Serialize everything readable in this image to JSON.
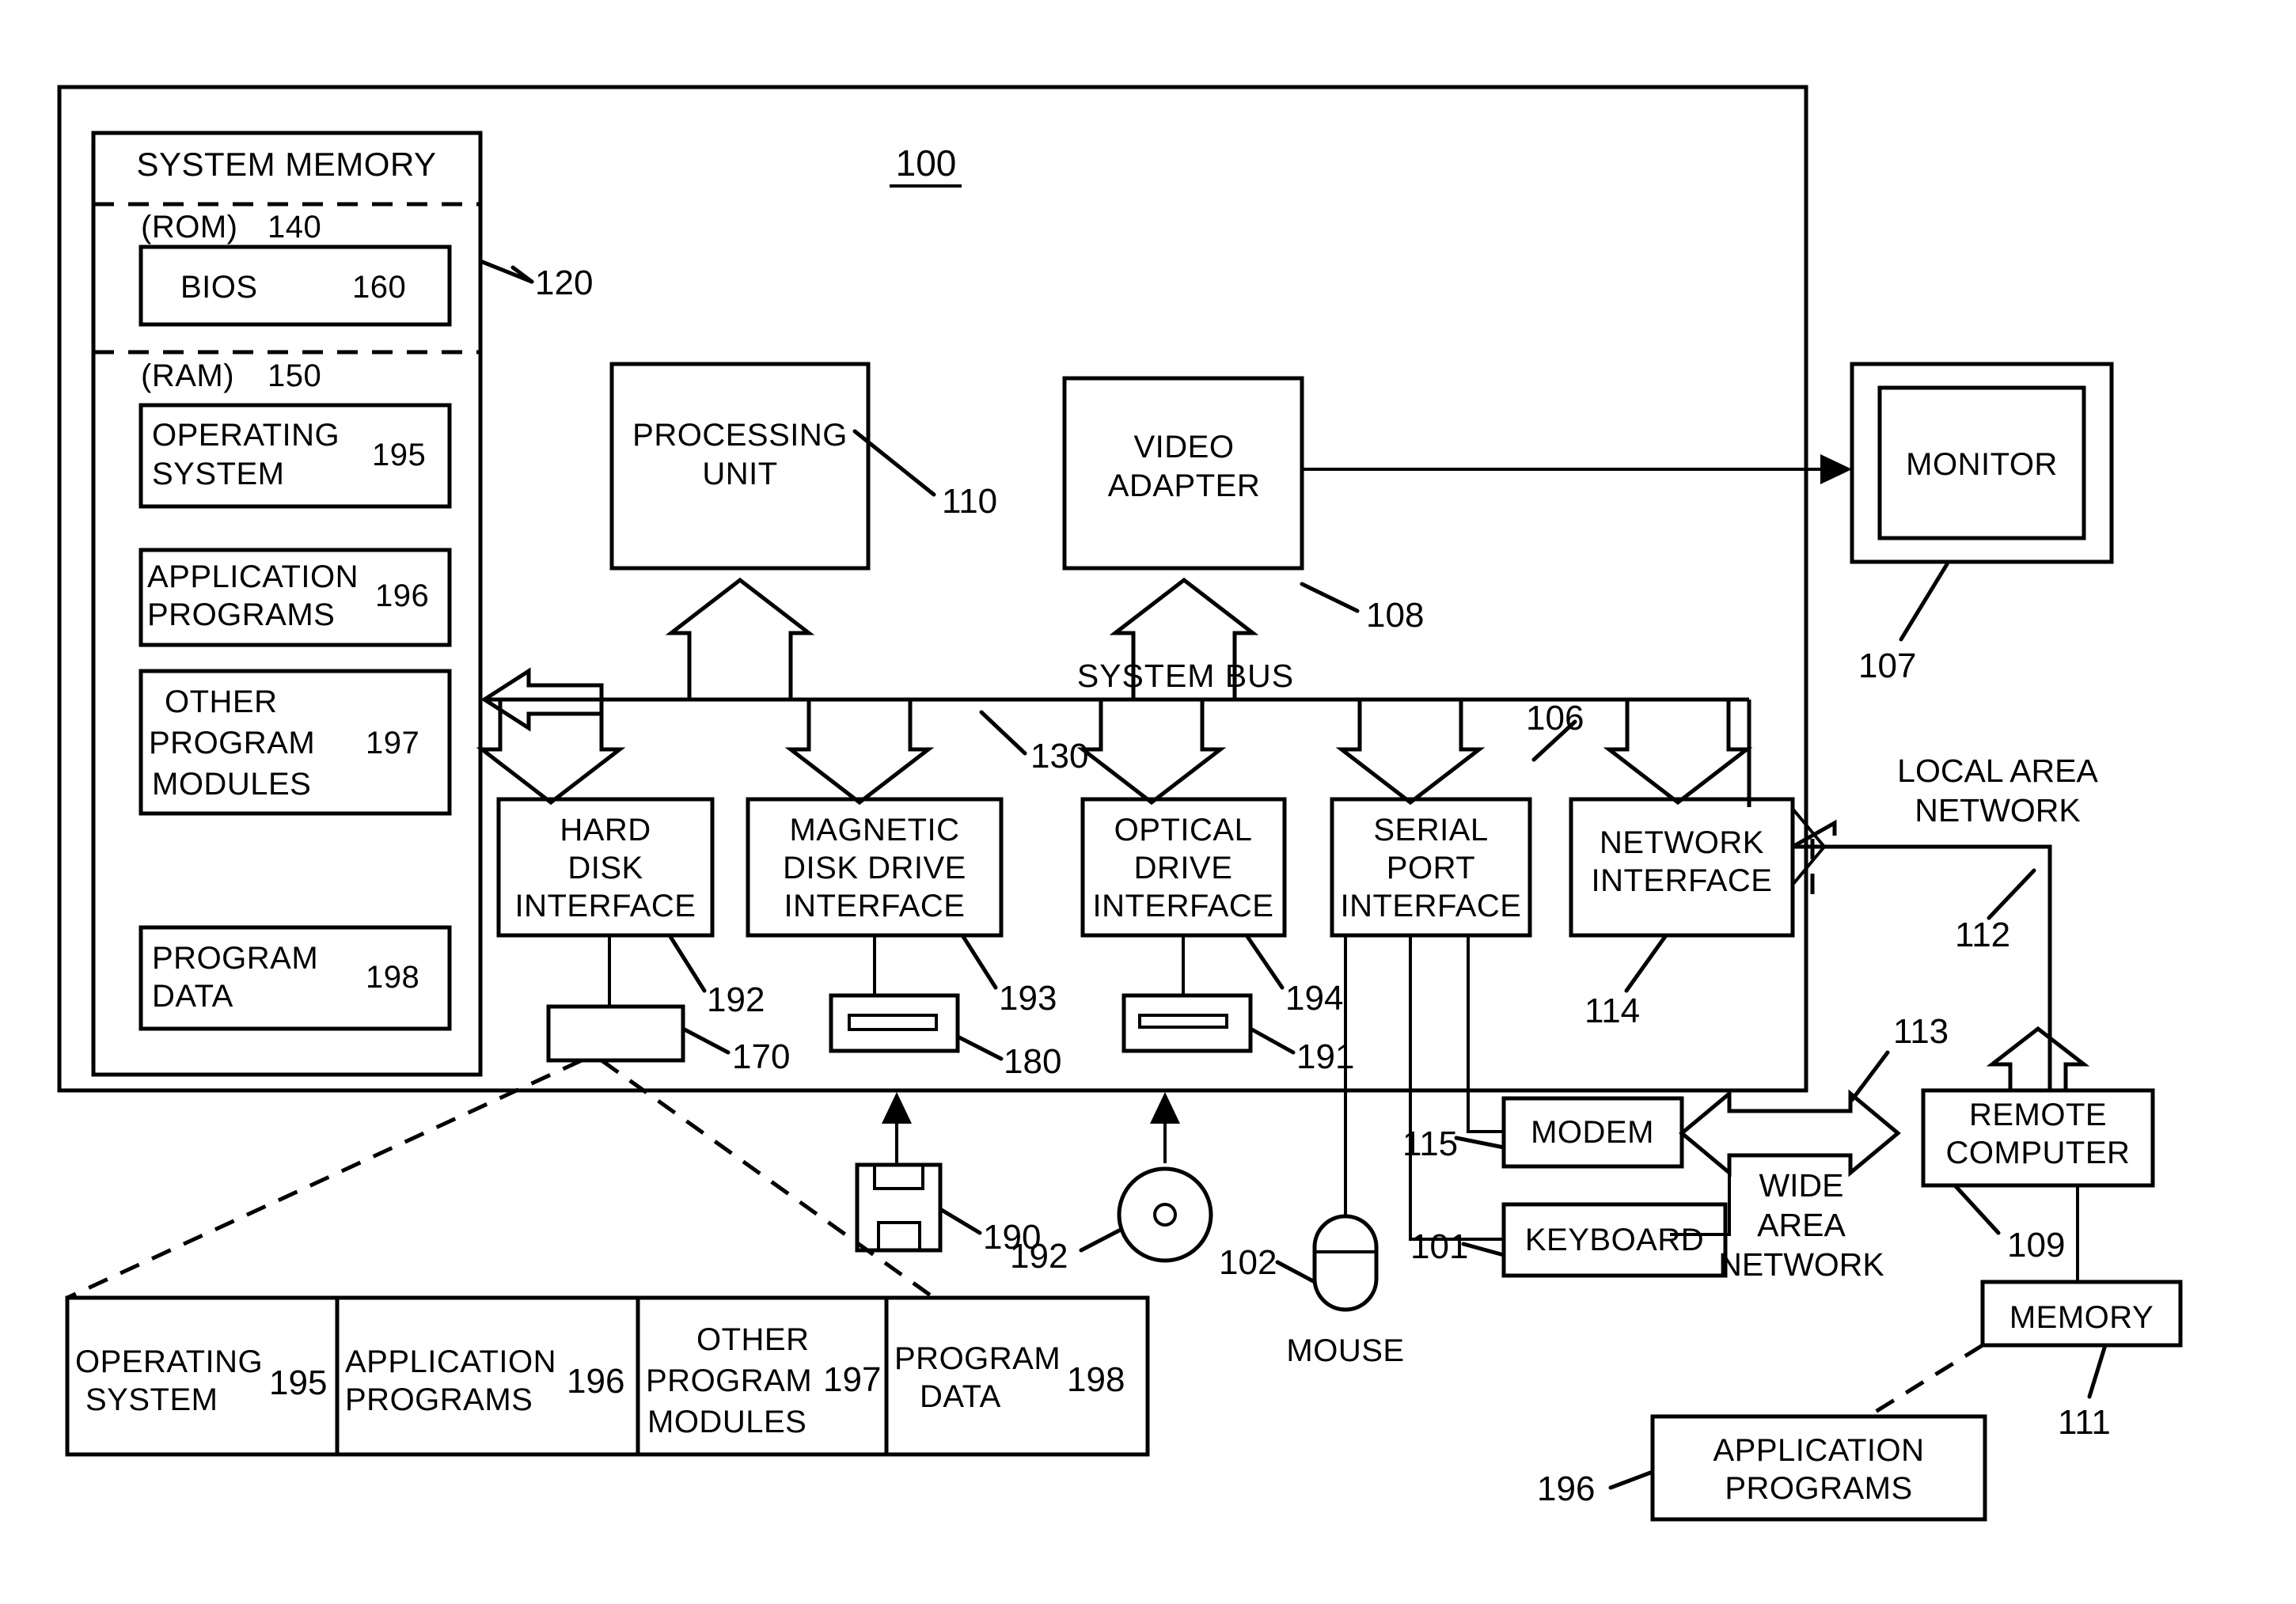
{
  "figure": {
    "title_ref": "100",
    "outer_system_ref": "120"
  },
  "system_memory": {
    "heading": "SYSTEM MEMORY",
    "rom": {
      "label": "(ROM)",
      "ref": "140"
    },
    "bios": {
      "label": "BIOS",
      "ref": "160"
    },
    "ram": {
      "label": "(RAM)",
      "ref": "150"
    },
    "blocks": [
      {
        "label_line1": "OPERATING",
        "label_line2": "SYSTEM",
        "label_line3": "",
        "ref": "195"
      },
      {
        "label_line1": "APPLICATION",
        "label_line2": "PROGRAMS",
        "label_line3": "",
        "ref": "196"
      },
      {
        "label_line1": "OTHER",
        "label_line2": "PROGRAM",
        "label_line3": "MODULES",
        "ref": "197"
      },
      {
        "label_line1": "PROGRAM",
        "label_line2": "DATA",
        "label_line3": "",
        "ref": "198"
      }
    ]
  },
  "core": {
    "processing_unit": {
      "line1": "PROCESSING",
      "line2": "UNIT",
      "ref": "110"
    },
    "video_adapter": {
      "line1": "VIDEO",
      "line2": "ADAPTER",
      "ref": "108"
    },
    "monitor": {
      "label": "MONITOR",
      "ref": "107"
    },
    "system_bus": {
      "label": "SYSTEM BUS",
      "ref": "130"
    },
    "serial_bus_ref": "106"
  },
  "interfaces": [
    {
      "line1": "HARD",
      "line2": "DISK",
      "line3": "INTERFACE",
      "ref": "192"
    },
    {
      "line1": "MAGNETIC",
      "line2": "DISK DRIVE",
      "line3": "INTERFACE",
      "ref": "193"
    },
    {
      "line1": "OPTICAL",
      "line2": "DRIVE",
      "line3": "INTERFACE",
      "ref": "194"
    },
    {
      "line1": "SERIAL",
      "line2": "PORT",
      "line3": "INTERFACE",
      "ref": ""
    },
    {
      "line1": "NETWORK",
      "line2": "INTERFACE",
      "line3": "",
      "ref": "114"
    }
  ],
  "drives": {
    "hard_disk_ref": "170",
    "magnetic_disk_drive_ref": "180",
    "optical_drive_ref": "191",
    "floppy_disk_ref": "190",
    "optical_disc_ref": "192"
  },
  "peripherals": {
    "mouse": {
      "label": "MOUSE",
      "ref": "102"
    },
    "keyboard": {
      "label": "KEYBOARD",
      "ref": "101"
    },
    "modem": {
      "label": "MODEM",
      "ref": "115"
    }
  },
  "networks": {
    "lan": {
      "line1": "LOCAL AREA",
      "line2": "NETWORK",
      "ref": "112"
    },
    "wan": {
      "line1": "WIDE",
      "line2": "AREA",
      "line3": "NETWORK",
      "ref": "113"
    }
  },
  "remote": {
    "computer": {
      "line1": "REMOTE",
      "line2": "COMPUTER",
      "ref": "109"
    },
    "memory": {
      "label": "MEMORY",
      "ref": "111"
    },
    "application_programs": {
      "line1": "APPLICATION",
      "line2": "PROGRAMS",
      "ref": "196"
    }
  },
  "expanded_storage": {
    "cells": [
      {
        "line1": "OPERATING",
        "line2": "SYSTEM",
        "line3": "",
        "ref": "195"
      },
      {
        "line1": "APPLICATION",
        "line2": "PROGRAMS",
        "line3": "",
        "ref": "196"
      },
      {
        "line1": "OTHER",
        "line2": "PROGRAM",
        "line3": "MODULES",
        "ref": "197"
      },
      {
        "line1": "PROGRAM",
        "line2": "DATA",
        "line3": "",
        "ref": "198"
      }
    ]
  }
}
